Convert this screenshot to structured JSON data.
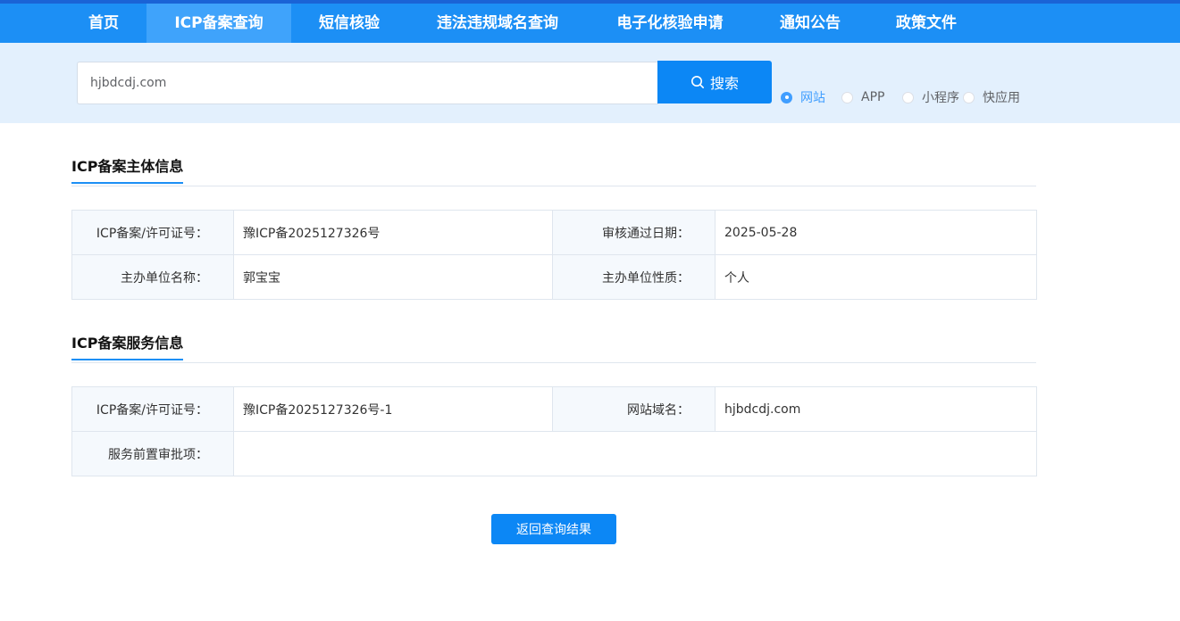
{
  "nav": {
    "items": [
      {
        "label": "首页"
      },
      {
        "label": "ICP备案查询"
      },
      {
        "label": "短信核验"
      },
      {
        "label": "违法违规域名查询"
      },
      {
        "label": "电子化核验申请"
      },
      {
        "label": "通知公告"
      },
      {
        "label": "政策文件"
      }
    ],
    "active_index": 1
  },
  "search": {
    "value": "hjbdcdj.com",
    "button_label": "搜索",
    "types": [
      {
        "label": "网站",
        "checked": true
      },
      {
        "label": "APP",
        "checked": false
      },
      {
        "label": "小程序",
        "checked": false
      },
      {
        "label": "快应用",
        "checked": false
      }
    ]
  },
  "subject_section": {
    "title": "ICP备案主体信息",
    "rows": [
      {
        "label1": "ICP备案/许可证号：",
        "value1": "豫ICP备2025127326号",
        "label2": "审核通过日期：",
        "value2": "2025-05-28"
      },
      {
        "label1": "主办单位名称：",
        "value1": "郭宝宝",
        "label2": "主办单位性质：",
        "value2": "个人"
      }
    ]
  },
  "service_section": {
    "title": "ICP备案服务信息",
    "row1": {
      "label1": "ICP备案/许可证号：",
      "value1": "豫ICP备2025127326号-1",
      "label2": "网站域名：",
      "value2": "hjbdcdj.com"
    },
    "row2": {
      "label": "服务前置审批项：",
      "value": ""
    }
  },
  "back_button_label": "返回查询结果",
  "colors": {
    "nav_bg": "#1c8ff5",
    "nav_active": "#3fa3fb",
    "search_area_bg": "#e3f0fd",
    "primary_button": "#0c87f5",
    "radio_checked": "#409eff"
  }
}
